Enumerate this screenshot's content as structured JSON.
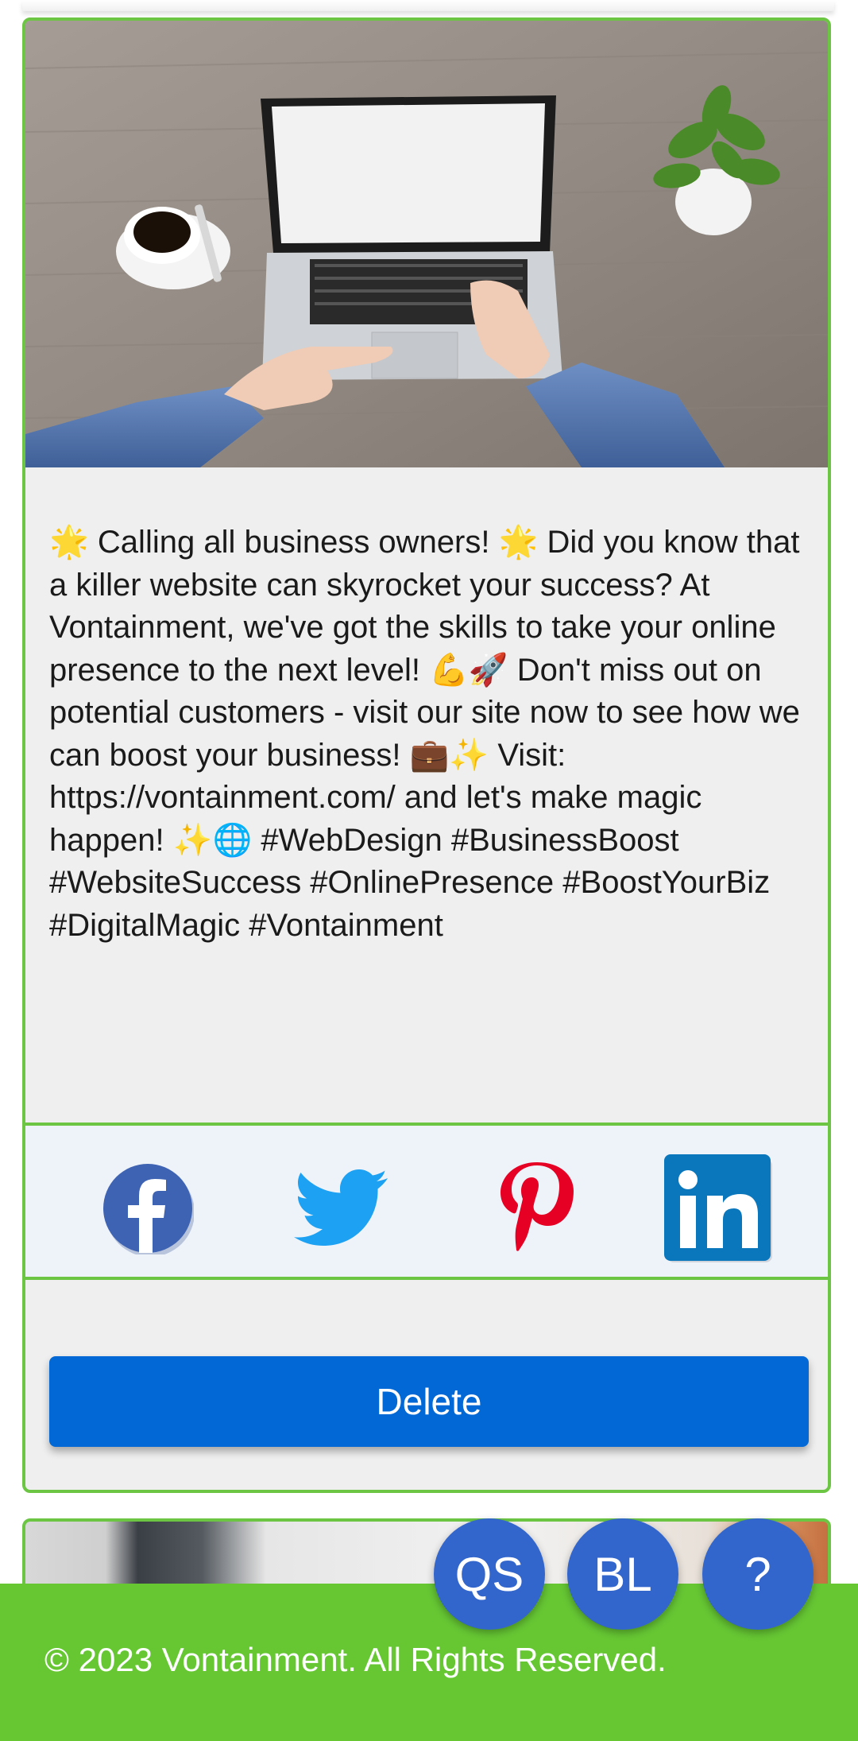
{
  "post": {
    "text": "🌟 Calling all business owners! 🌟 Did you know that a killer website can skyrocket your success? At Vontainment, we've got the skills to take your online presence to the next level! 💪🚀 Don't miss out on potential customers - visit our site now to see how we can boost your business! 💼✨ Visit: https://vontainment.com/ and let's make magic happen! ✨🌐 #WebDesign #BusinessBoost #WebsiteSuccess #OnlinePresence #BoostYourBiz #DigitalMagic #Vontainment",
    "image_subject": "laptop on wooden desk with coffee cup and plant"
  },
  "share": {
    "items": [
      {
        "name": "facebook",
        "icon": "facebook-icon",
        "color": "#3b5998"
      },
      {
        "name": "twitter",
        "icon": "twitter-icon",
        "color": "#1da1f2"
      },
      {
        "name": "pinterest",
        "icon": "pinterest-icon",
        "color": "#e60023"
      },
      {
        "name": "linkedin",
        "icon": "linkedin-icon",
        "color": "#0077b5"
      }
    ]
  },
  "actions": {
    "delete_label": "Delete"
  },
  "fabs": {
    "qs_label": "QS",
    "bl_label": "BL",
    "help_label": "?"
  },
  "footer": {
    "copyright": "© 2023 Vontainment. All Rights Reserved."
  },
  "colors": {
    "accent_green": "#6cc644",
    "footer_green": "#66c733",
    "primary_blue": "#0268d6",
    "fab_blue": "#3366cc"
  }
}
